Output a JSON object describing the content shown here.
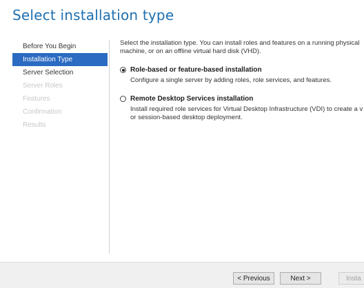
{
  "page": {
    "title": "Select installation type"
  },
  "sidebar": {
    "items": [
      {
        "label": "Before You Begin"
      },
      {
        "label": "Installation Type"
      },
      {
        "label": "Server Selection"
      },
      {
        "label": "Server Roles"
      },
      {
        "label": "Features"
      },
      {
        "label": "Confirmation"
      },
      {
        "label": "Results"
      }
    ]
  },
  "main": {
    "intro_line1": "Select the installation type. You can install roles and features on a running physical",
    "intro_line2": "machine, or on an offline virtual hard disk (VHD).",
    "options": [
      {
        "title": "Role-based or feature-based installation",
        "desc1": "Configure a single server by adding roles, role services, and features.",
        "desc2": "",
        "selected": true
      },
      {
        "title": "Remote Desktop Services installation",
        "desc1": "Install required role services for Virtual Desktop Infrastructure (VDI) to create a v",
        "desc2": "or session-based desktop deployment.",
        "selected": false
      }
    ]
  },
  "footer": {
    "previous_label": "< Previous",
    "next_label": "Next >",
    "install_label": "Insta"
  }
}
